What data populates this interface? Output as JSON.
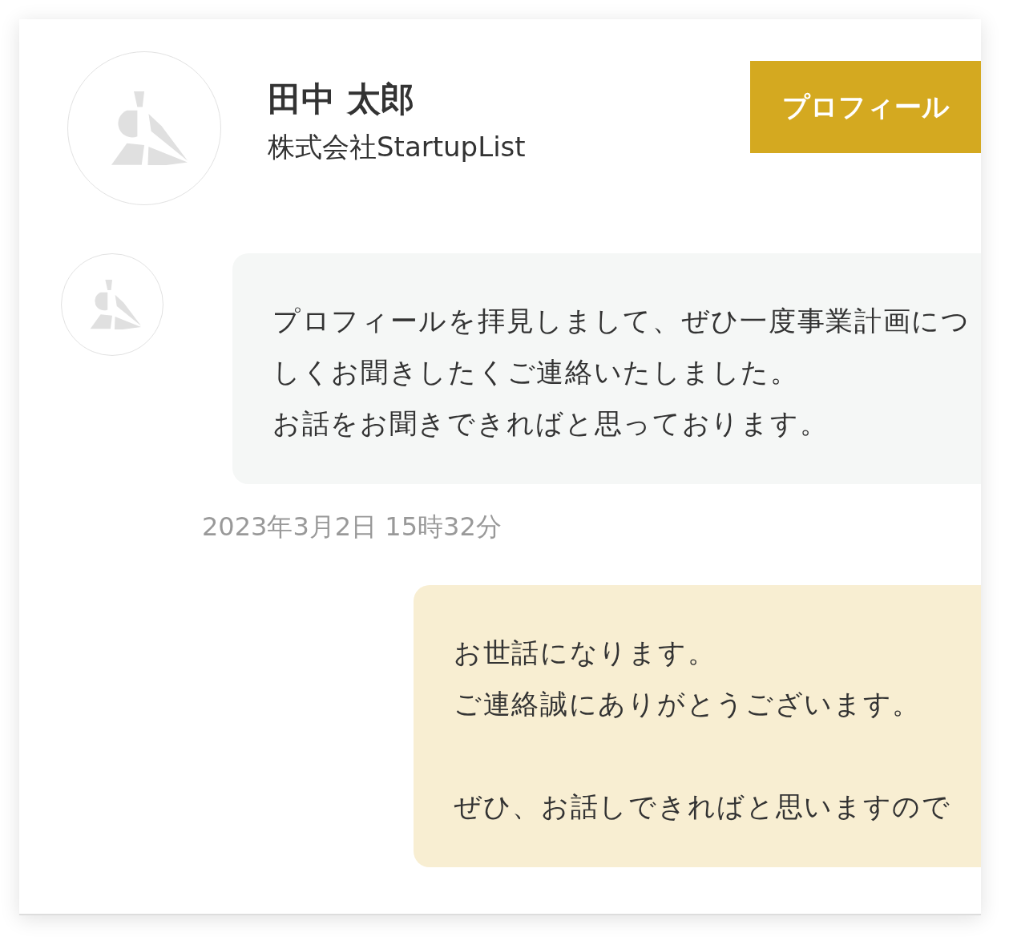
{
  "profile": {
    "name": "田中 太郎",
    "company": "株式会社StartupList",
    "button": "プロフィール"
  },
  "messages": [
    {
      "kind": "received",
      "paragraphs": [
        [
          "プロフィールを拝見しまして、ぜひ一度事業計画につ",
          "しくお聞きしたくご連絡いたしました。",
          "お話をお聞きできればと思っております。"
        ]
      ],
      "timestamp": "2023年3月2日 15時32分"
    },
    {
      "kind": "sent",
      "paragraphs": [
        [
          "お世話になります。",
          "ご連絡誠にありがとうございます。"
        ],
        [
          "ぜひ、お話しできればと思いますので"
        ]
      ]
    }
  ]
}
